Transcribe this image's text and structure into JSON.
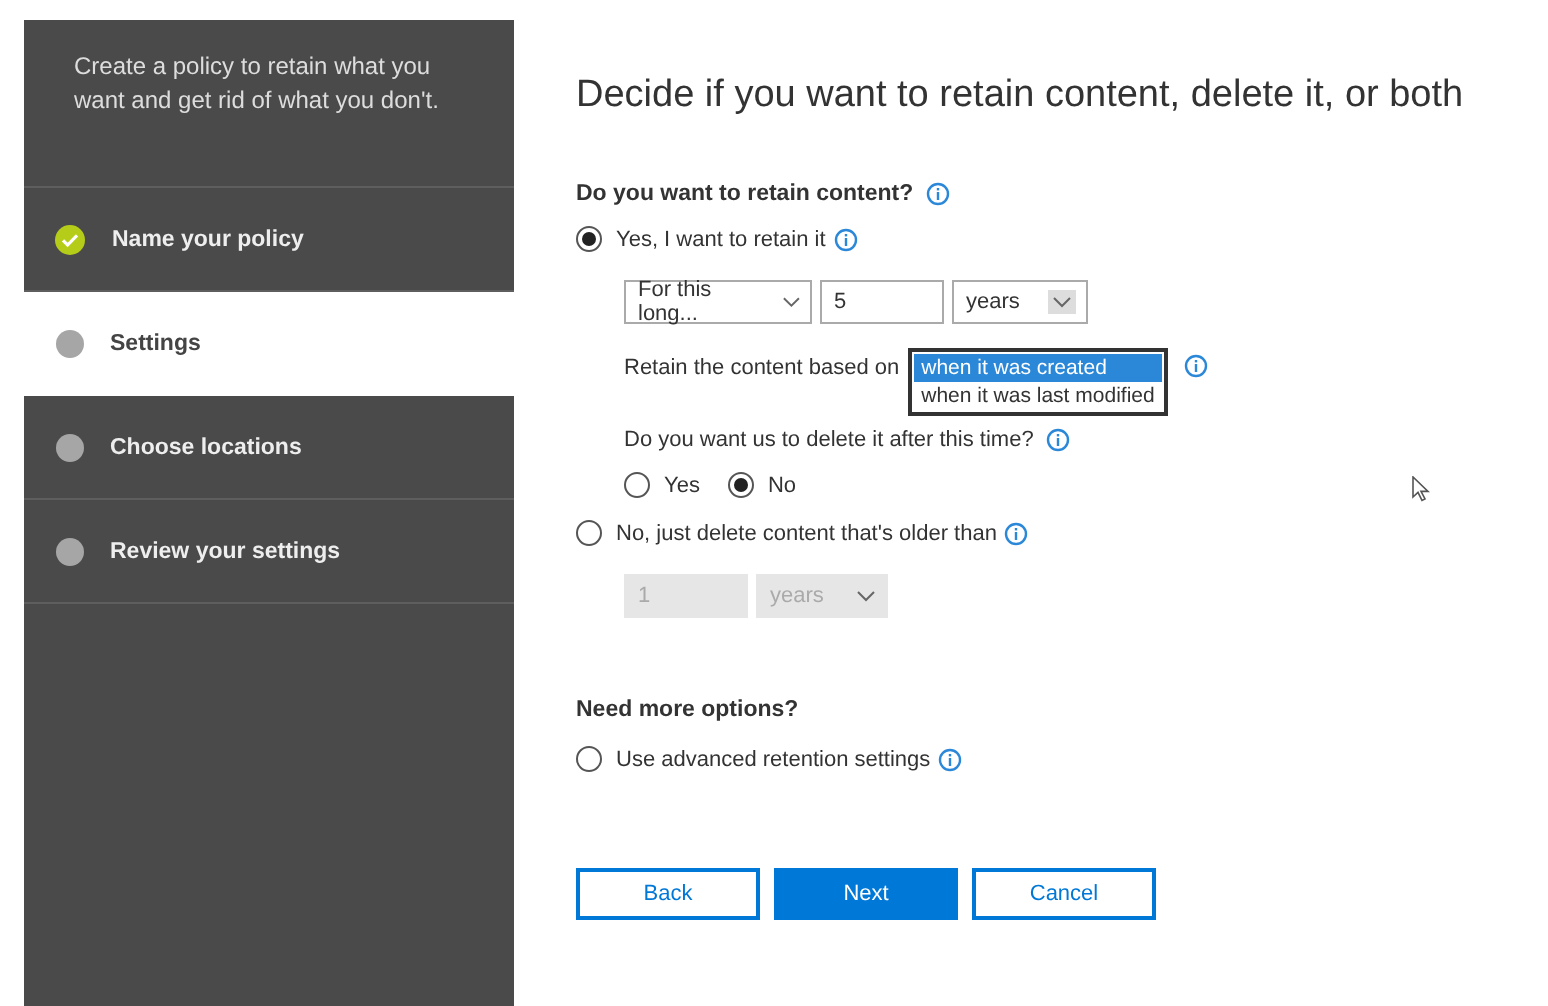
{
  "sidebar": {
    "intro": "Create a policy to retain what you want and get rid of what you don't.",
    "steps": [
      {
        "label": "Name your policy",
        "selected": false,
        "completed": true
      },
      {
        "label": "Settings",
        "selected": true,
        "completed": false
      },
      {
        "label": "Choose locations",
        "selected": false,
        "completed": false
      },
      {
        "label": "Review your settings",
        "selected": false,
        "completed": false
      }
    ]
  },
  "title": "Decide if you want to retain content, delete it, or both",
  "retain": {
    "heading": "Do you want to retain content?",
    "options": [
      {
        "label": "Yes, I want to retain it",
        "selected": true
      },
      {
        "label": "No, just delete content that's older than",
        "selected": false
      }
    ],
    "duration": "For this long...",
    "amount": "5",
    "unit": "years",
    "based_on_label": "Retain the content based on",
    "based_on_list": [
      {
        "label": "when it was created",
        "selected": true
      },
      {
        "label": "when it was last modified",
        "selected": false
      }
    ],
    "delete_question": "Do you want us to delete it after this time?",
    "delete_choices": [
      {
        "label": "Yes",
        "selected": false
      },
      {
        "label": "No",
        "selected": true
      }
    ],
    "delete_amount": "1",
    "delete_unit": "years",
    "delete_disabled": true
  },
  "more": {
    "heading": "Need more options?",
    "option": {
      "label": "Use advanced retention settings",
      "selected": false
    }
  },
  "buttons": [
    {
      "label": "Back",
      "kind": "secondary"
    },
    {
      "label": "Next",
      "kind": "primary"
    },
    {
      "label": "Cancel",
      "kind": "secondary"
    }
  ]
}
